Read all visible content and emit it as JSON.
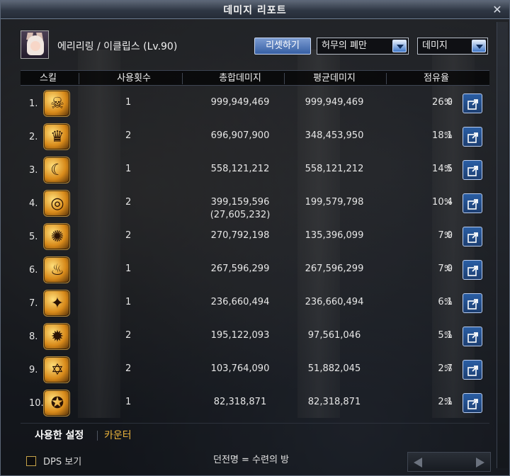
{
  "window": {
    "title": "데미지 리포트",
    "close_icon": "close-icon"
  },
  "character": {
    "name": "에리리링 / 이클립스 (Lv.90)",
    "portrait_icon": "character-portrait"
  },
  "controls": {
    "reset_label": "리셋하기",
    "dungeon_select": "허무의 폐만",
    "mode_select": "데미지"
  },
  "table": {
    "headers": {
      "skill": "스킬",
      "uses": "사용횟수",
      "total": "총합데미지",
      "average": "평균데미지",
      "share": "점유율"
    },
    "rows": [
      {
        "rank": "1.",
        "icon": "skill-icon-1",
        "uses": "1",
        "total": "999,949,469",
        "total_sub": "",
        "avg": "999,949,469",
        "share": "26.0",
        "pct": "%"
      },
      {
        "rank": "2.",
        "icon": "skill-icon-2",
        "uses": "2",
        "total": "696,907,900",
        "total_sub": "",
        "avg": "348,453,950",
        "share": "18.1",
        "pct": "%"
      },
      {
        "rank": "3.",
        "icon": "skill-icon-3",
        "uses": "1",
        "total": "558,121,212",
        "total_sub": "",
        "avg": "558,121,212",
        "share": "14.5",
        "pct": "%"
      },
      {
        "rank": "4.",
        "icon": "skill-icon-4",
        "uses": "2",
        "total": "399,159,596",
        "total_sub": "(27,605,232)",
        "avg": "199,579,798",
        "share": "10.4",
        "pct": "%"
      },
      {
        "rank": "5.",
        "icon": "skill-icon-5",
        "uses": "2",
        "total": "270,792,198",
        "total_sub": "",
        "avg": "135,396,099",
        "share": "7.0",
        "pct": "%"
      },
      {
        "rank": "6.",
        "icon": "skill-icon-6",
        "uses": "1",
        "total": "267,596,299",
        "total_sub": "",
        "avg": "267,596,299",
        "share": "7.0",
        "pct": "%"
      },
      {
        "rank": "7.",
        "icon": "skill-icon-7",
        "uses": "1",
        "total": "236,660,494",
        "total_sub": "",
        "avg": "236,660,494",
        "share": "6.1",
        "pct": "%"
      },
      {
        "rank": "8.",
        "icon": "skill-icon-8",
        "uses": "2",
        "total": "195,122,093",
        "total_sub": "",
        "avg": "97,561,046",
        "share": "5.1",
        "pct": "%"
      },
      {
        "rank": "9.",
        "icon": "skill-icon-9",
        "uses": "2",
        "total": "103,764,090",
        "total_sub": "",
        "avg": "51,882,045",
        "share": "2.7",
        "pct": "%"
      },
      {
        "rank": "10.",
        "icon": "skill-icon-10",
        "uses": "1",
        "total": "82,318,871",
        "total_sub": "",
        "avg": "82,318,871",
        "share": "2.1",
        "pct": "%"
      }
    ]
  },
  "tabs": {
    "used": "사용한 설정",
    "counter": "카운터"
  },
  "footer": {
    "dps_label": "DPS 보기",
    "dungeon_name": "던전명 = 수련의 방"
  }
}
